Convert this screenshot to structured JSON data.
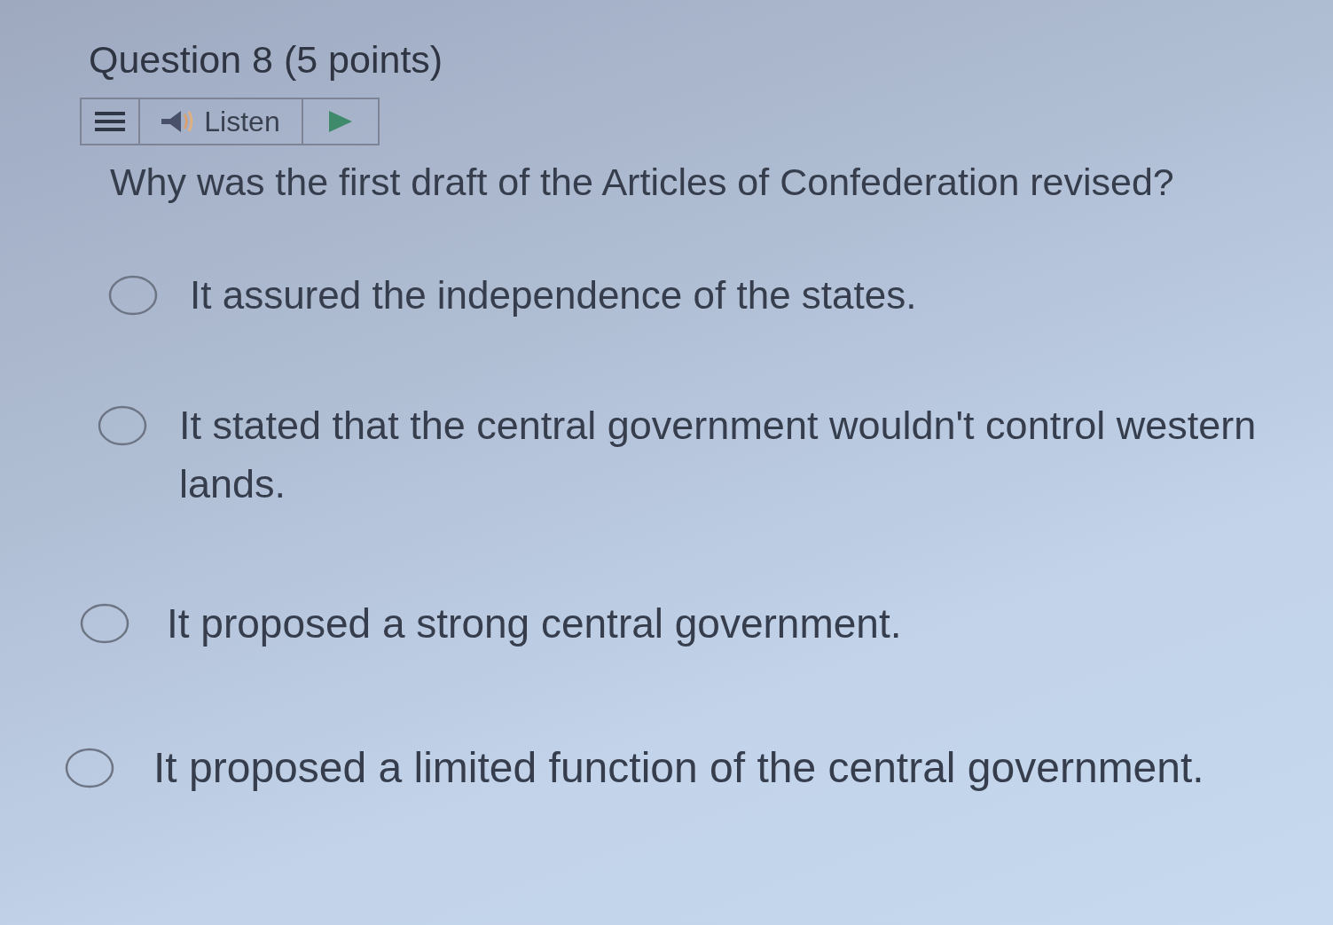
{
  "question": {
    "title": "Question 8 (5 points)",
    "toolbar": {
      "listen_label": "Listen"
    },
    "prompt": "Why was the first draft of the Articles of Confederation revised?",
    "options": [
      {
        "text": "It assured the independence of the states.",
        "selected": false
      },
      {
        "text": "It stated that the central government wouldn't control western lands.",
        "selected": false
      },
      {
        "text": "It proposed a strong central government.",
        "selected": false
      },
      {
        "text": "It proposed a limited function of the central government.",
        "selected": false
      }
    ]
  }
}
